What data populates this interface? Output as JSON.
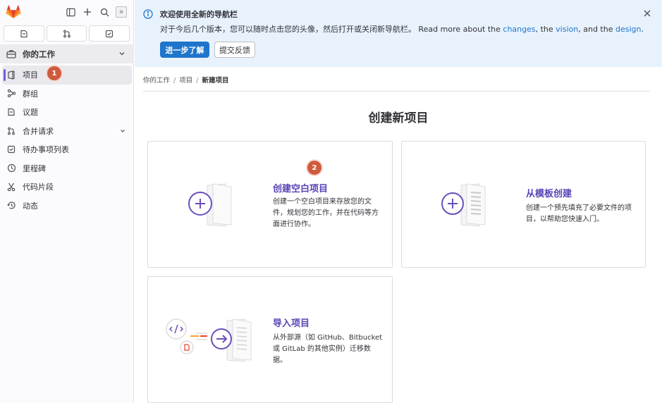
{
  "sidebar": {
    "avatar_alt": "a",
    "context": {
      "label": "你的工作"
    },
    "items": [
      {
        "label": "项目"
      },
      {
        "label": "群组"
      },
      {
        "label": "议题"
      },
      {
        "label": "合并请求"
      },
      {
        "label": "待办事项列表"
      },
      {
        "label": "里程碑"
      },
      {
        "label": "代码片段"
      },
      {
        "label": "动态"
      }
    ]
  },
  "markers": {
    "m1": "1",
    "m2": "2"
  },
  "banner": {
    "title": "欢迎使用全新的导航栏",
    "text_before": "对于今后几个版本，您可以随时点击您的头像，然后打开或关闭新导航栏。 Read more about the ",
    "link_changes": "changes",
    "text_mid1": ", the ",
    "link_vision": "vision",
    "text_mid2": ", and the ",
    "link_design": "design",
    "text_end": ".",
    "primary_button": "进一步了解",
    "secondary_button": "提交反馈"
  },
  "breadcrumb": {
    "c1": "你的工作",
    "c2": "项目",
    "c3": "新建项目",
    "sep": "/"
  },
  "page": {
    "title": "创建新项目"
  },
  "cards": [
    {
      "title": "创建空白项目",
      "desc_lines": [
        "创建一个空白项目来存放您的文",
        "件，规划您的工作，并在代码等方",
        "面进行协作。"
      ]
    },
    {
      "title": "从模板创建",
      "desc_lines": [
        "创建一个预先填充了必要文件的项",
        "目，以帮助您快速入门。"
      ]
    },
    {
      "title": "导入项目",
      "desc_lines": [
        "从外部源（如 GitHub、Bitbucket",
        "或 GitLab 的其他实例）迁移数",
        "据。"
      ]
    }
  ],
  "colors": {
    "accent": "#1f75cb",
    "purple": "#5943b6",
    "marker": "#cf5a3e",
    "banner_bg": "#e8f2fd"
  }
}
